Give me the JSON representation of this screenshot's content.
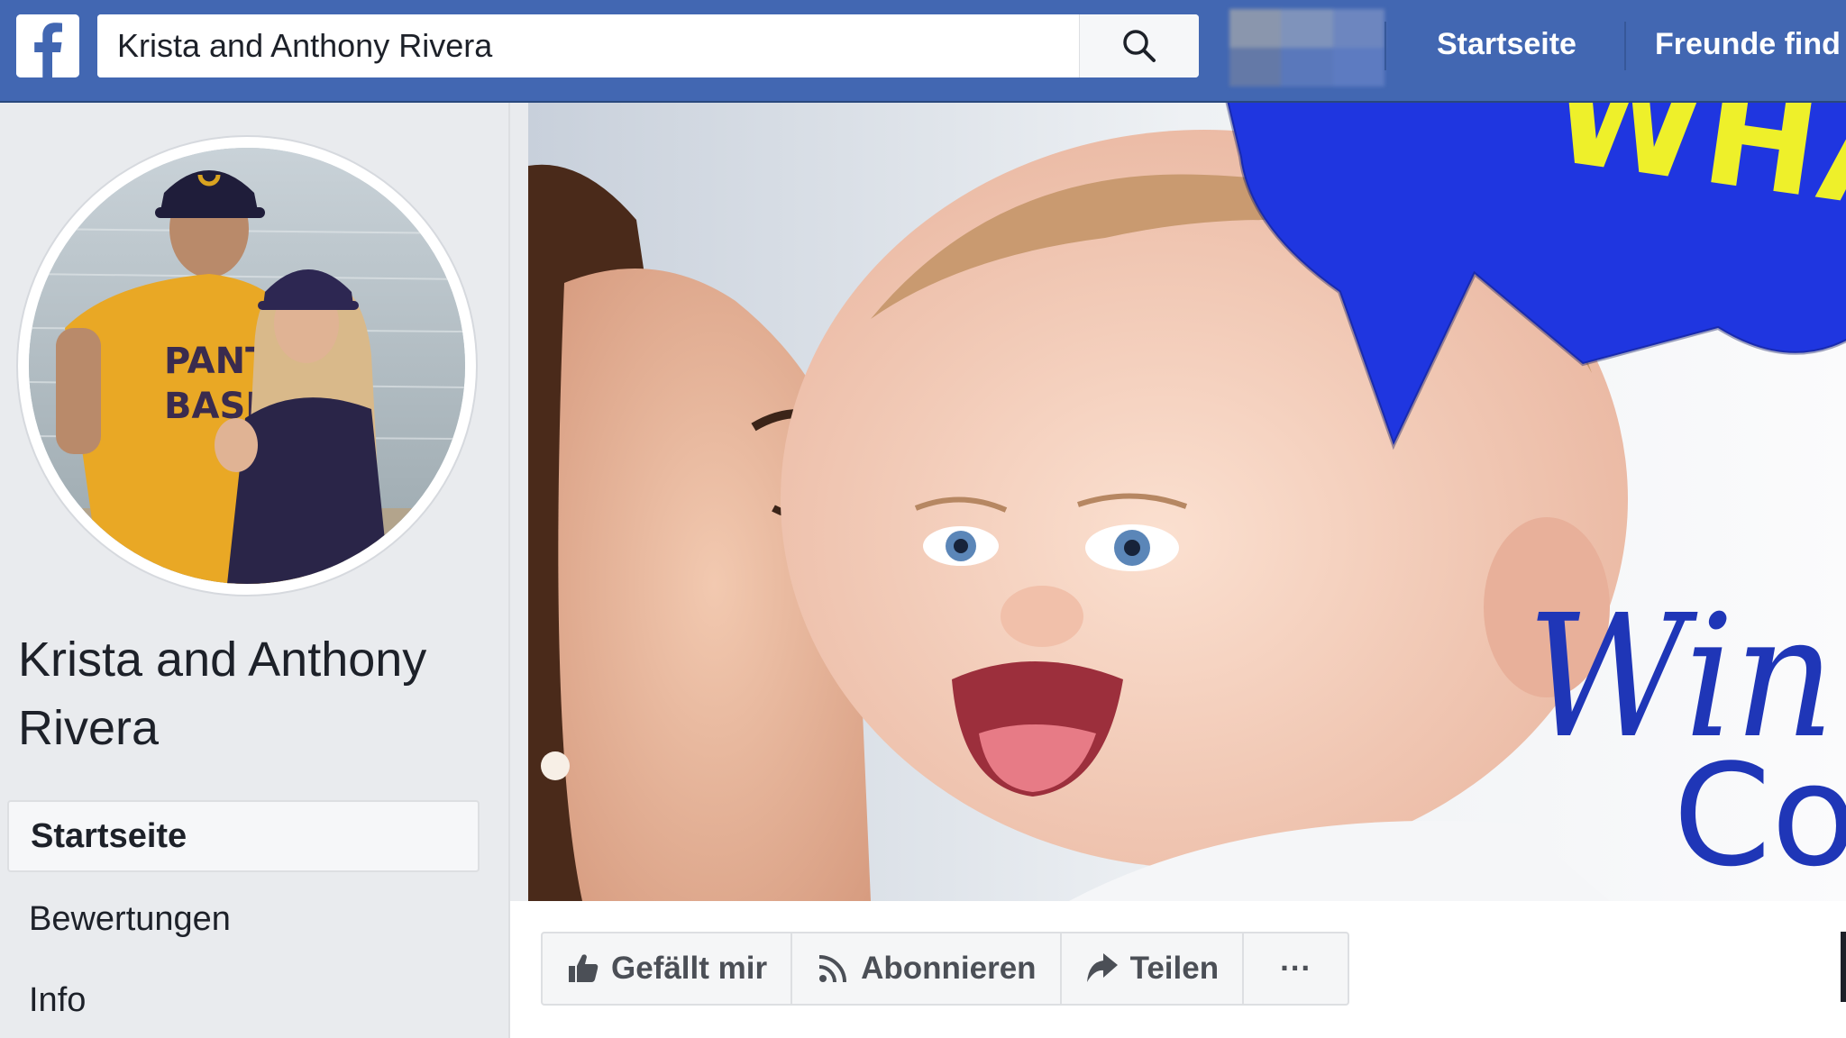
{
  "header": {
    "logo": "facebook-f-icon",
    "search_value": "Krista and Anthony Rivera",
    "search_icon": "magnifier-icon",
    "nav": [
      {
        "label": "Startseite"
      },
      {
        "label": "Freunde find"
      }
    ]
  },
  "profile": {
    "name": "Krista and Anthony Rivera",
    "shirt_text_1": "PANTHER",
    "shirt_text_2": "BASEBALL"
  },
  "sidebar": {
    "items": [
      {
        "label": "Startseite",
        "active": true
      },
      {
        "label": "Bewertungen",
        "active": false
      },
      {
        "label": "Info",
        "active": false
      }
    ]
  },
  "cover": {
    "bubble_text": "WHA",
    "text_line_1": "Win",
    "text_line_2": "Co",
    "colors": {
      "bubble": "#1f36e0",
      "text": "#1f36b7",
      "bubble_text": "#eef02a"
    }
  },
  "actions": [
    {
      "label": "Gefällt mir",
      "icon": "thumbs-up-icon"
    },
    {
      "label": "Abonnieren",
      "icon": "rss-feed-icon"
    },
    {
      "label": "Teilen",
      "icon": "share-arrow-icon"
    },
    {
      "label": "···",
      "icon": "more-dots-icon"
    }
  ],
  "colors": {
    "brand": "#4267b2",
    "background": "#e9ebee",
    "text": "#1d2129",
    "secondary_text": "#4b4f56"
  }
}
